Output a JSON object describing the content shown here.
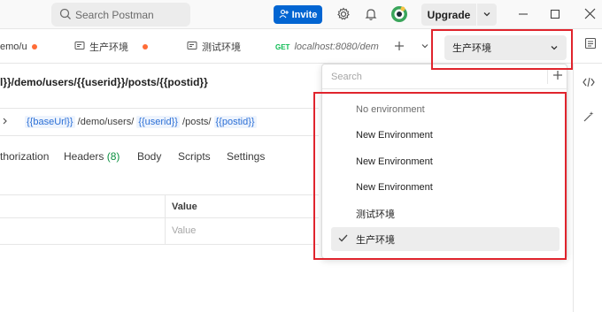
{
  "topbar": {
    "search_placeholder": "Search Postman",
    "invite_label": "Invite",
    "upgrade_label": "Upgrade"
  },
  "tabs": [
    {
      "label": "emo/u",
      "unsaved": true
    },
    {
      "label": "生产环境",
      "unsaved": true
    },
    {
      "label": "测试环境",
      "unsaved": false
    },
    {
      "method": "GET",
      "label": "localhost:8080/dem",
      "unsaved": false
    }
  ],
  "environment_selector": {
    "selected": "生产环境"
  },
  "request": {
    "title": "l}}/demo/users/{{userid}}/posts/{{postid}}",
    "url_parts": {
      "var1": "{{baseUrl}}",
      "seg1": " /demo/users/ ",
      "var2": "{{userid}}",
      "seg2": " /posts/ ",
      "var3": "{{postid}}"
    },
    "tabs": {
      "authorization": "thorization",
      "headers": "Headers",
      "headers_count": "(8)",
      "body": "Body",
      "scripts": "Scripts",
      "settings": "Settings"
    },
    "table": {
      "value_header": "Value",
      "value_placeholder": "Value"
    }
  },
  "dropdown": {
    "search_placeholder": "Search",
    "items": [
      {
        "label": "No environment",
        "muted": true,
        "selected": false
      },
      {
        "label": "New Environment",
        "muted": false,
        "selected": false
      },
      {
        "label": "New Environment",
        "muted": false,
        "selected": false
      },
      {
        "label": "New Environment",
        "muted": false,
        "selected": false
      },
      {
        "label": "测试环境",
        "muted": false,
        "selected": false
      },
      {
        "label": "生产环境",
        "muted": false,
        "selected": true
      }
    ]
  },
  "colors": {
    "accent": "#0265d2",
    "unsaved_dot": "#ff6c37",
    "highlight_box": "#e0242d",
    "get_method": "#0cbb52"
  },
  "icons": [
    "search-icon",
    "add-user-icon",
    "gear-icon",
    "bell-icon",
    "avatar",
    "chevron-down-icon",
    "plus-icon",
    "minimize-icon",
    "maximize-icon",
    "close-icon",
    "tab-request-icon",
    "check-icon",
    "code-icon",
    "docs-icon",
    "magic-icon"
  ]
}
